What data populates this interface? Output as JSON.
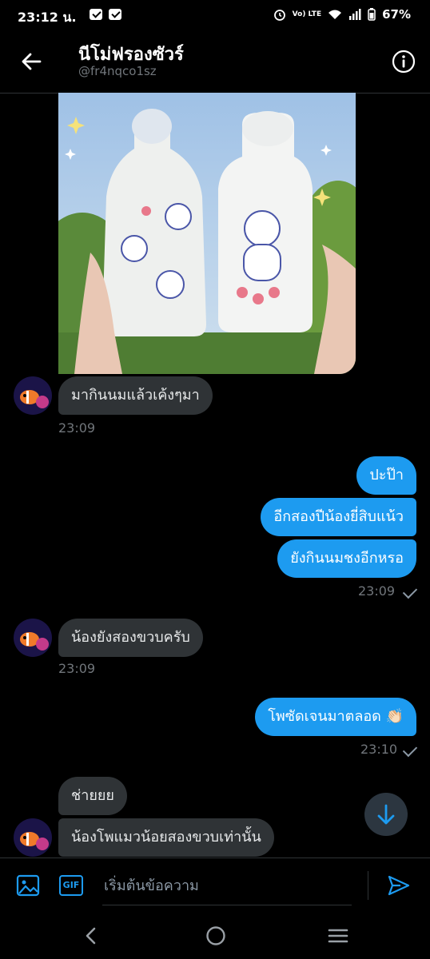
{
  "status_bar": {
    "time": "23:12 น.",
    "battery": "67%",
    "network": "Vo) LTE"
  },
  "header": {
    "title": "นีโม่ฟรองซัวร์",
    "handle": "@fr4nqco1sz"
  },
  "messages": [
    {
      "direction": "in",
      "text": "มากินนมแล้วเค้งๆมา",
      "time": "23:09"
    },
    {
      "direction": "out",
      "text": "ปะป๊า"
    },
    {
      "direction": "out",
      "text": "อีกสองปีน้องยี่สิบแน้ว"
    },
    {
      "direction": "out",
      "text": "ยังกินนมชงอีกหรอ",
      "time": "23:09"
    },
    {
      "direction": "in",
      "text": "น้องยังสองขวบครับ",
      "time": "23:09"
    },
    {
      "direction": "out",
      "text": "โพซัดเจนมาตลอด 👏🏻",
      "time": "23:10"
    },
    {
      "direction": "in",
      "text": "ช่ายยย"
    },
    {
      "direction": "in",
      "text": "น้องโพแมวน้อยสองขวบเท่านั้น"
    }
  ],
  "composer": {
    "placeholder": "เริ่มต้นข้อความ",
    "gif_label": "GIF"
  },
  "colors": {
    "accent": "#1d9bf0",
    "incoming_bubble": "#2f3336",
    "background": "#000000"
  },
  "icons": [
    "back-arrow-icon",
    "info-icon",
    "image-icon",
    "gif-icon",
    "send-icon",
    "arrow-down-icon",
    "nav-back-icon",
    "nav-home-icon",
    "nav-recents-icon"
  ]
}
